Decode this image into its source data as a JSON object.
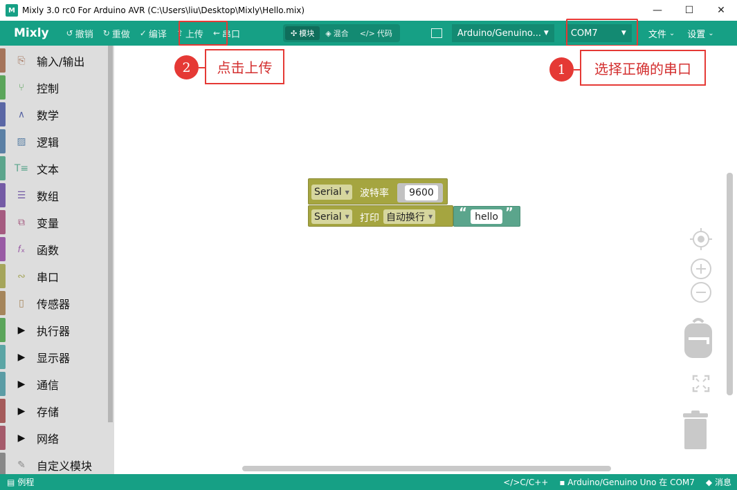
{
  "window": {
    "title": "Mixly 3.0 rc0 For Arduino AVR (C:\\Users\\liu\\Desktop\\Mixly\\Hello.mix)",
    "minimize": "—",
    "maximize": "☐",
    "close": "✕"
  },
  "toolbar": {
    "brand": "Mixly",
    "undo": "撤销",
    "redo": "重做",
    "compile": "编译",
    "upload": "上传",
    "serial": "串口",
    "modes": {
      "blocks": "模块",
      "mixed": "混合",
      "code": "代码"
    },
    "board": "Arduino/Genuino...",
    "port": "COM7",
    "file_menu": "文件",
    "settings_menu": "设置"
  },
  "annotations": {
    "step1_num": "1",
    "step1_text": "选择正确的串口",
    "step2_num": "2",
    "step2_text": "点击上传"
  },
  "sidebar": {
    "items": [
      {
        "label": "输入/输出",
        "color": "#a5745b",
        "icon": "io-icon"
      },
      {
        "label": "控制",
        "color": "#5ba55b",
        "icon": "control-icon"
      },
      {
        "label": "数学",
        "color": "#5b67a5",
        "icon": "math-icon"
      },
      {
        "label": "逻辑",
        "color": "#5b80a5",
        "icon": "logic-icon"
      },
      {
        "label": "文本",
        "color": "#5ba58c",
        "icon": "text-icon"
      },
      {
        "label": "数组",
        "color": "#745ba5",
        "icon": "array-icon"
      },
      {
        "label": "变量",
        "color": "#a55b80",
        "icon": "variable-icon"
      },
      {
        "label": "函数",
        "color": "#995ba5",
        "icon": "function-icon"
      },
      {
        "label": "串口",
        "color": "#a5a55b",
        "icon": "serial-icon"
      },
      {
        "label": "传感器",
        "color": "#a5855b",
        "icon": "sensor-icon"
      },
      {
        "label": "执行器",
        "color": "#5ba55b",
        "icon": "expand-icon"
      },
      {
        "label": "显示器",
        "color": "#5ba5a5",
        "icon": "expand-icon"
      },
      {
        "label": "通信",
        "color": "#5b9ca5",
        "icon": "expand-icon"
      },
      {
        "label": "存储",
        "color": "#a55b5b",
        "icon": "expand-icon"
      },
      {
        "label": "网络",
        "color": "#a55b6b",
        "icon": "expand-icon"
      },
      {
        "label": "自定义模块",
        "color": "#888888",
        "icon": "custom-icon"
      }
    ]
  },
  "blocks": {
    "setup": {
      "serial": "Serial",
      "label": "波特率",
      "value": "9600"
    },
    "print": {
      "serial": "Serial",
      "label": "打印",
      "mode": "自动换行",
      "open_quote": "“",
      "text": "hello",
      "close_quote": "”"
    }
  },
  "statusbar": {
    "examples": "例程",
    "language": "</>C/C++",
    "board_port": "Arduino/Genuino Uno 在 COM7",
    "messages": "消息"
  }
}
